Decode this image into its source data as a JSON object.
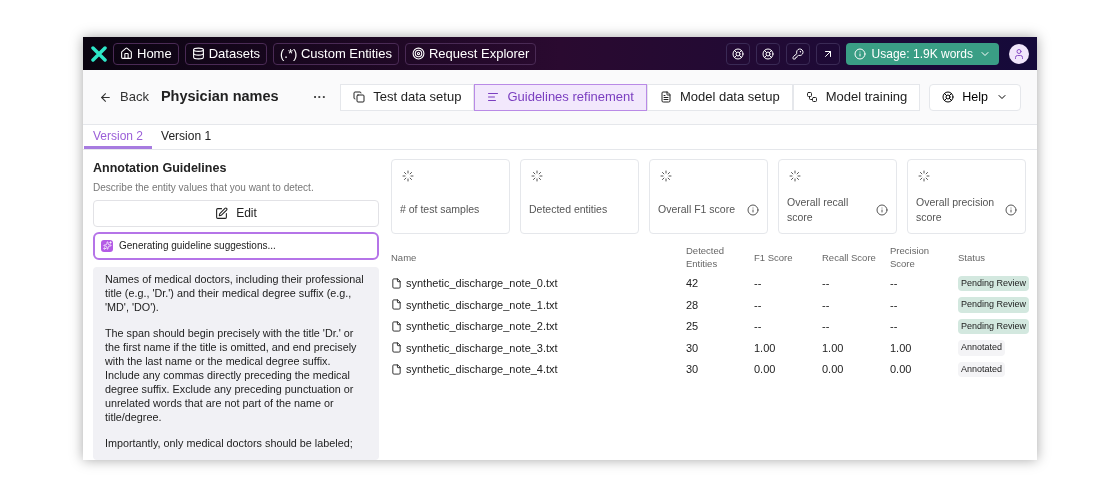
{
  "nav": {
    "items": [
      {
        "label": "Home"
      },
      {
        "label": "Datasets"
      },
      {
        "label": "(.*) Custom Entities"
      },
      {
        "label": "Request Explorer"
      }
    ],
    "usage": "Usage: 1.9K words"
  },
  "header": {
    "back": "Back",
    "title": "Physician names",
    "more": "···",
    "steps": [
      {
        "label": "Test data setup",
        "selected": false
      },
      {
        "label": "Guidelines refinement",
        "selected": true
      },
      {
        "label": "Model data setup",
        "selected": false
      },
      {
        "label": "Model training",
        "selected": false
      }
    ],
    "help": "Help"
  },
  "versions": [
    {
      "label": "Version 2",
      "selected": true
    },
    {
      "label": "Version 1",
      "selected": false
    }
  ],
  "guidelines": {
    "title": "Annotation Guidelines",
    "subtitle": "Describe the entity values that you want to detect.",
    "edit": "Edit",
    "status": "Generating guideline suggestions...",
    "paragraphs": [
      "Names of medical doctors, including their professional title (e.g., 'Dr.') and their medical degree suffix (e.g., 'MD', 'DO').",
      "The span should begin precisely with the title 'Dr.' or the first name if the title is omitted, and end precisely with the last name or the medical degree suffix. Include any commas directly preceding the medical degree suffix. Exclude any preceding punctuation or unrelated words that are not part of the name or title/degree.",
      "Importantly, only medical doctors should be labeled;"
    ]
  },
  "metrics": [
    {
      "label": "# of test samples",
      "info": false
    },
    {
      "label": "Detected entities",
      "info": false
    },
    {
      "label": "Overall F1 score",
      "info": true
    },
    {
      "label": "Overall recall score",
      "info": true
    },
    {
      "label": "Overall precision score",
      "info": true
    }
  ],
  "table": {
    "columns": [
      "Name",
      "Detected Entities",
      "F1 Score",
      "Recall Score",
      "Precision Score",
      "Status"
    ],
    "rows": [
      {
        "name": "synthetic_discharge_note_0.txt",
        "entities": "42",
        "f1": "--",
        "recall": "--",
        "precision": "--",
        "status": "Pending Review",
        "kind": "pending"
      },
      {
        "name": "synthetic_discharge_note_1.txt",
        "entities": "28",
        "f1": "--",
        "recall": "--",
        "precision": "--",
        "status": "Pending Review",
        "kind": "pending"
      },
      {
        "name": "synthetic_discharge_note_2.txt",
        "entities": "25",
        "f1": "--",
        "recall": "--",
        "precision": "--",
        "status": "Pending Review",
        "kind": "pending"
      },
      {
        "name": "synthetic_discharge_note_3.txt",
        "entities": "30",
        "f1": "1.00",
        "recall": "1.00",
        "precision": "1.00",
        "status": "Annotated",
        "kind": "annotated"
      },
      {
        "name": "synthetic_discharge_note_4.txt",
        "entities": "30",
        "f1": "0.00",
        "recall": "0.00",
        "precision": "0.00",
        "status": "Annotated",
        "kind": "annotated"
      }
    ]
  }
}
